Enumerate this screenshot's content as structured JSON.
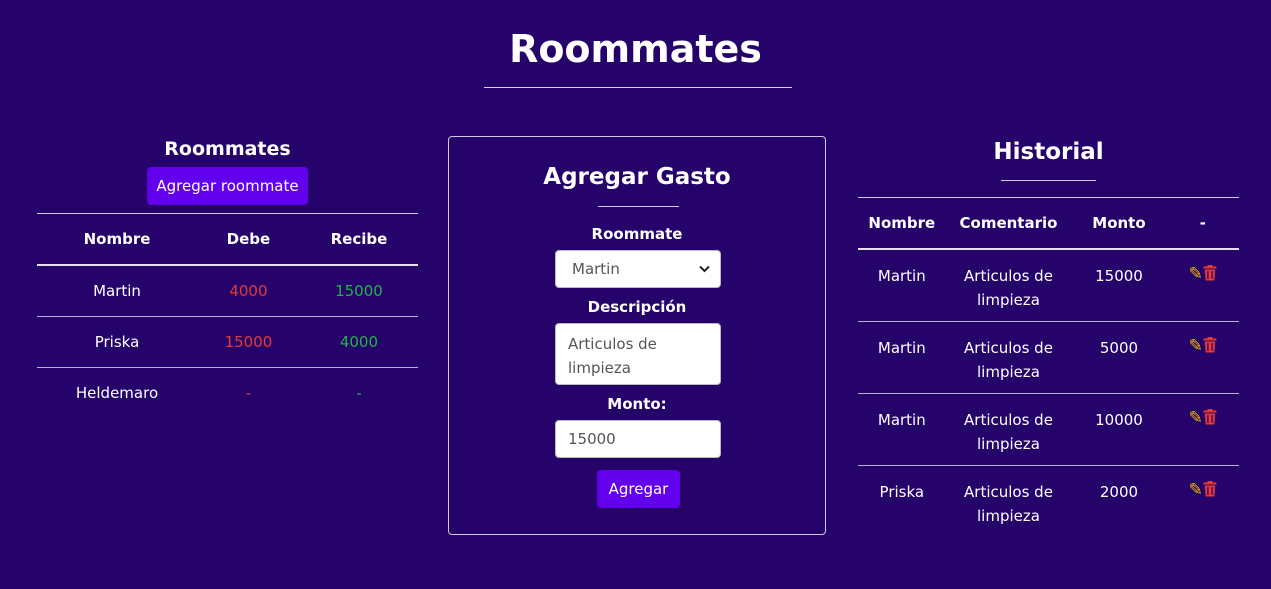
{
  "page": {
    "title": "Roommates"
  },
  "roommates": {
    "heading": "Roommates",
    "add_button": "Agregar roommate",
    "columns": [
      "Nombre",
      "Debe",
      "Recibe"
    ],
    "rows": [
      {
        "nombre": "Martin",
        "debe": "4000",
        "recibe": "15000"
      },
      {
        "nombre": "Priska",
        "debe": "15000",
        "recibe": "4000"
      },
      {
        "nombre": "Heldemaro",
        "debe": "-",
        "recibe": "-"
      }
    ]
  },
  "form": {
    "heading": "Agregar Gasto",
    "roommate_label": "Roommate",
    "roommate_selected": "Martin",
    "descripcion_label": "Descripción",
    "descripcion_value": "Articulos de limpieza",
    "monto_label": "Monto:",
    "monto_value": "15000",
    "submit_label": "Agregar"
  },
  "historial": {
    "heading": "Historial",
    "columns": [
      "Nombre",
      "Comentario",
      "Monto",
      "-"
    ],
    "rows": [
      {
        "nombre": "Martin",
        "comentario": "Articulos de limpieza",
        "monto": "15000"
      },
      {
        "nombre": "Martin",
        "comentario": "Articulos de limpieza",
        "monto": "5000"
      },
      {
        "nombre": "Martin",
        "comentario": "Articulos de limpieza",
        "monto": "10000"
      },
      {
        "nombre": "Priska",
        "comentario": "Articulos de limpieza",
        "monto": "2000"
      }
    ]
  },
  "colors": {
    "background": "#25036b",
    "accent": "#6200ee",
    "debe": "#e53935",
    "recibe": "#22b34a",
    "edit": "#f5b800",
    "delete": "#e53935"
  },
  "icons": {
    "edit": "edit-icon",
    "delete": "trash-icon",
    "select": "chevron-down-icon"
  }
}
